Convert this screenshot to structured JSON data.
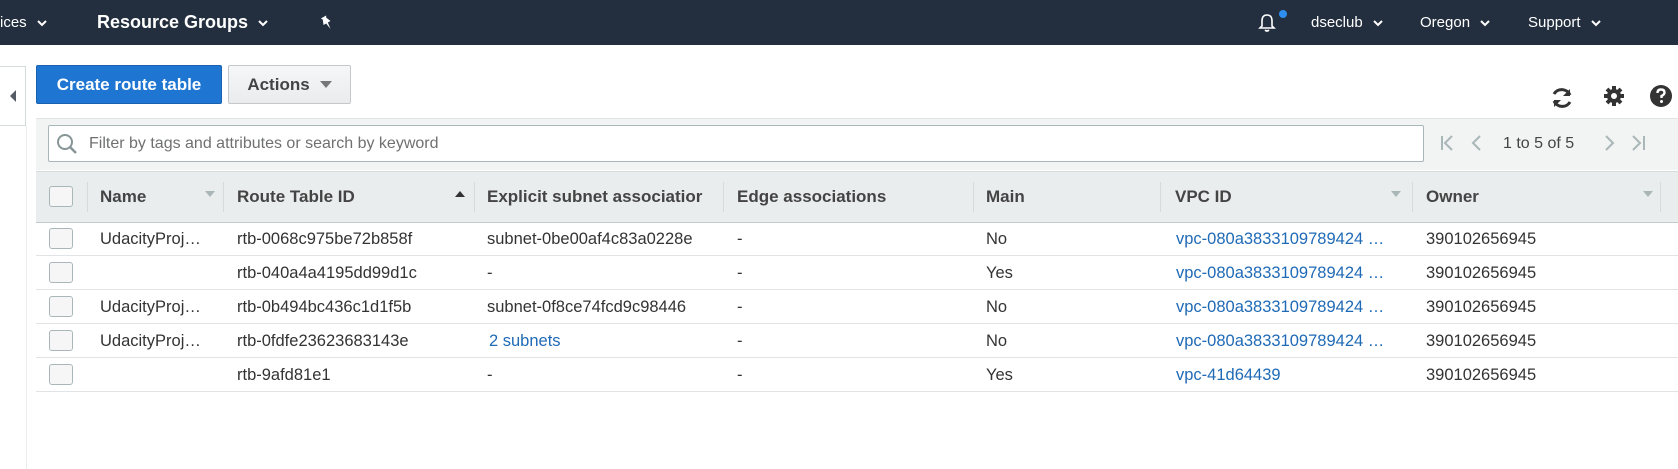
{
  "nav": {
    "services": "ices",
    "resource_groups": "Resource Groups",
    "user": "dseclub",
    "region": "Oregon",
    "support": "Support"
  },
  "toolbar": {
    "create_label": "Create route table",
    "actions_label": "Actions"
  },
  "search": {
    "placeholder": "Filter by tags and attributes or search by keyword"
  },
  "pagination": {
    "text": "1 to 5 of 5"
  },
  "columns": [
    "Name",
    "Route Table ID",
    "Explicit subnet associatior",
    "Edge associations",
    "Main",
    "VPC ID",
    "Owner"
  ],
  "rows": [
    {
      "name": "UdacityProj…",
      "id": "rtb-0068c975be72b858f",
      "subnet": "subnet-0be00af4c83a0228e",
      "edge": "-",
      "main": "No",
      "vpc": "vpc-080a3833109789424 …",
      "owner": "390102656945"
    },
    {
      "name": "",
      "id": "rtb-040a4a4195dd99d1c",
      "subnet": "-",
      "edge": "-",
      "main": "Yes",
      "vpc": "vpc-080a3833109789424 …",
      "owner": "390102656945"
    },
    {
      "name": "UdacityProj…",
      "id": "rtb-0b494bc436c1d1f5b",
      "subnet": "subnet-0f8ce74fcd9c98446",
      "edge": "-",
      "main": "No",
      "vpc": "vpc-080a3833109789424 …",
      "owner": "390102656945"
    },
    {
      "name": "UdacityProj…",
      "id": "rtb-0fdfe23623683143e",
      "subnet": "2 subnets",
      "edge": "-",
      "main": "No",
      "vpc": "vpc-080a3833109789424 …",
      "owner": "390102656945"
    },
    {
      "name": "",
      "id": "rtb-9afd81e1",
      "subnet": "-",
      "edge": "-",
      "main": "Yes",
      "vpc": "vpc-41d64439",
      "owner": "390102656945"
    }
  ],
  "icons": {
    "pin": "pin-icon",
    "bell": "bell-icon",
    "refresh": "refresh-icon",
    "settings": "gear-icon",
    "help": "help-icon",
    "search": "search-icon"
  },
  "colors": {
    "nav_bg": "#232f3e",
    "primary": "#1f76d2",
    "link": "#1f6ab6"
  }
}
